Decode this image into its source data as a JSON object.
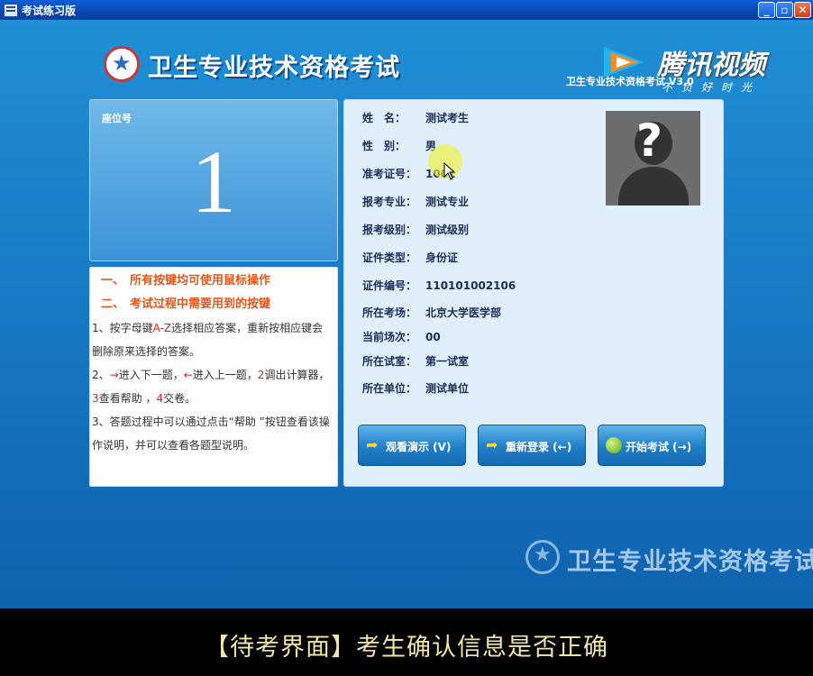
{
  "window": {
    "title": "考试练习版",
    "min_icon": "minimize-icon",
    "max_icon": "maximize-icon",
    "close_icon": "close-icon"
  },
  "header": {
    "logo_title": "卫生专业技术资格考试",
    "version": "卫生专业技术资格考试 V3.0"
  },
  "watermark": {
    "brand": "腾讯视频",
    "slogan": "不负好时光"
  },
  "seat": {
    "label": "座位号",
    "number": "1"
  },
  "instructions": {
    "heading1_num": "一、",
    "heading1": "所有按键均可使用鼠标操作",
    "heading2_num": "二、",
    "heading2": "考试过程中需要用到的按键",
    "p1_a": "1、按字母键",
    "p1_key": "A-Z",
    "p1_b": "选择相应答案，重新按相应键会删除原来选择的答案。",
    "p2_a": "2、",
    "p2_right": "→",
    "p2_b": "进入下一题，",
    "p2_left": "←",
    "p2_c": "进入上一题，",
    "p2_k2": "2",
    "p2_d": "调出计算器，",
    "p2_k3": "3",
    "p2_e": "查看帮助 ，",
    "p2_k4": "4",
    "p2_f": "交卷。",
    "p3": "3、答题过程中可以通过点击“帮助 ”按钮查看该操作说明，并可以查看各题型说明。"
  },
  "candidate": {
    "fields": [
      {
        "label": "姓　名：",
        "value": "测试考生"
      },
      {
        "label": "性　别：",
        "value": "男"
      },
      {
        "label": "准考证号：",
        "value": "1001"
      },
      {
        "label": "报考专业：",
        "value": "测试专业"
      },
      {
        "label": "报考级别：",
        "value": "测试级别"
      },
      {
        "label": "证件类型：",
        "value": "身份证"
      },
      {
        "label": "证件编号：",
        "value": "110101002106"
      },
      {
        "label": "所在考场：",
        "value": "北京大学医学部"
      },
      {
        "label": "当前场次：",
        "value": "00"
      },
      {
        "label": "所在试室：",
        "value": "第一试室"
      },
      {
        "label": "所在单位：",
        "value": "测试单位"
      }
    ],
    "photo_icon": "unknown-person-icon"
  },
  "buttons": {
    "demo": "观看演示 (V)",
    "relogin": "重新登录 (←)",
    "start": "开始考试 (→)"
  },
  "footer": {
    "logo_title": "卫生专业技术资格考试"
  },
  "subtitle": "【待考界面】考生确认信息是否正确",
  "colors": {
    "background": "#1677c3",
    "accent_orange": "#e2581c",
    "key_red": "#e02020",
    "panel": "#dff0fb"
  }
}
